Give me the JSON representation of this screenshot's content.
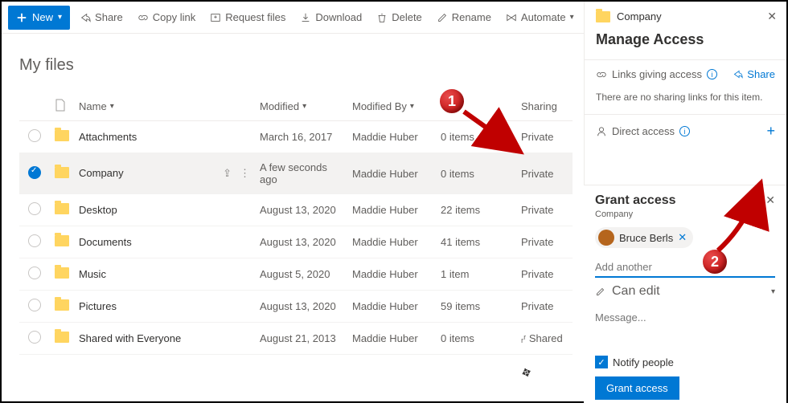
{
  "toolbar": {
    "new": "New",
    "share": "Share",
    "copylink": "Copy link",
    "request": "Request files",
    "download": "Download",
    "delete": "Delete",
    "rename": "Rename",
    "automate": "Automate"
  },
  "page_title": "My files",
  "columns": {
    "name": "Name",
    "modified": "Modified",
    "modifiedby": "Modified By",
    "filesize": "",
    "sharing": "Sharing"
  },
  "rows": [
    {
      "name": "Attachments",
      "modified": "March 16, 2017",
      "by": "Maddie Huber",
      "size": "0 items",
      "sharing": "Private",
      "sel": false
    },
    {
      "name": "Company",
      "modified": "A few seconds ago",
      "by": "Maddie Huber",
      "size": "0 items",
      "sharing": "Private",
      "sel": true
    },
    {
      "name": "Desktop",
      "modified": "August 13, 2020",
      "by": "Maddie Huber",
      "size": "22 items",
      "sharing": "Private",
      "sel": false
    },
    {
      "name": "Documents",
      "modified": "August 13, 2020",
      "by": "Maddie Huber",
      "size": "41 items",
      "sharing": "Private",
      "sel": false
    },
    {
      "name": "Music",
      "modified": "August 5, 2020",
      "by": "Maddie Huber",
      "size": "1 item",
      "sharing": "Private",
      "sel": false
    },
    {
      "name": "Pictures",
      "modified": "August 13, 2020",
      "by": "Maddie Huber",
      "size": "59 items",
      "sharing": "Private",
      "sel": false
    },
    {
      "name": "Shared with Everyone",
      "modified": "August 21, 2013",
      "by": "Maddie Huber",
      "size": "0 items",
      "sharing": "ᵣʳ Shared",
      "sel": false
    }
  ],
  "panel": {
    "folder_name": "Company",
    "title": "Manage Access",
    "links_label": "Links giving access",
    "share": "Share",
    "no_links": "There are no sharing links for this item.",
    "direct": "Direct access"
  },
  "grant": {
    "title": "Grant access",
    "sub": "Company",
    "chip_name": "Bruce Berls",
    "add_placeholder": "Add another",
    "perm": "Can edit",
    "msg_placeholder": "Message...",
    "notify": "Notify people",
    "button": "Grant access"
  },
  "callouts": {
    "one": "1",
    "two": "2"
  }
}
